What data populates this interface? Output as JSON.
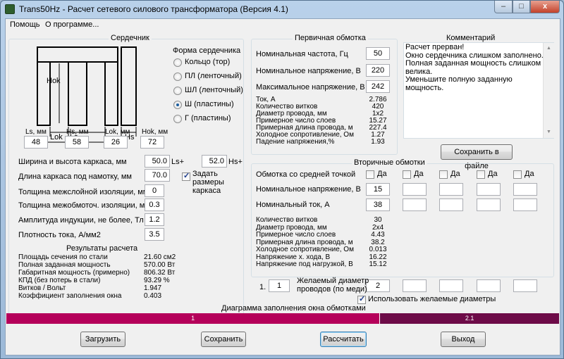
{
  "window": {
    "title": "Trans50Hz - Расчет сетевого силового трансформатора (Версия 4.1)",
    "min": "–",
    "max": "□",
    "close": "x"
  },
  "menu": {
    "help": "Помощь",
    "about": "О программе..."
  },
  "core": {
    "title": "Сердечник",
    "form_title": "Форма сердечника",
    "diagram": {
      "hok": "Hok",
      "lok": "Lok",
      "ls": "Ls",
      "hs": "Hs"
    },
    "radios": [
      {
        "label": "Кольцо  (тор)",
        "checked": false
      },
      {
        "label": "ПЛ  (ленточный)",
        "checked": false
      },
      {
        "label": "ШЛ  (ленточный)",
        "checked": false
      },
      {
        "label": "Ш  (пластины)",
        "checked": true
      },
      {
        "label": "Г  (пластины)",
        "checked": false
      }
    ],
    "dims": [
      {
        "label": "Ls, мм",
        "value": "48"
      },
      {
        "label": "Hs, мм",
        "value": "58"
      },
      {
        "label": "Lok, мм",
        "value": "26"
      },
      {
        "label": "Hok, мм",
        "value": "72"
      }
    ],
    "frame_label": "Ширина и высота каркаса, мм",
    "frame_w": "50.0",
    "frame_w_unit": "Ls+",
    "frame_h": "52.0",
    "frame_h_unit": "Hs+",
    "length_label": "Длина каркаса под намотку, мм",
    "length_value": "70.0",
    "set_frame_label": "Задать размеры каркаса",
    "set_frame_checked": true,
    "interlayer_label": "Толщина межслойной изоляции, мм",
    "interlayer_value": "0",
    "interwinding_label": "Толщина межобмоточ. изоляции, мм",
    "interwinding_value": "0.3",
    "induction_label": "Амплитуда индукции, не более, Тл",
    "induction_value": "1.2",
    "current_density_label": "Плотность тока, А/мм2",
    "current_density_value": "3.5",
    "results_title": "Результаты расчета",
    "results": [
      {
        "label": "Площадь сечения по стали",
        "value": "21.60 см2"
      },
      {
        "label": "Полная заданная мощность",
        "value": "570.00 Вт"
      },
      {
        "label": "Габаритная мощность (примерно)",
        "value": "806.32 Вт"
      },
      {
        "label": "КПД (без потерь в стали)",
        "value": "93.29 %"
      },
      {
        "label": "Витков / Вольт",
        "value": "1.947"
      },
      {
        "label": "Коэффициент заполнения окна",
        "value": "0.403"
      }
    ]
  },
  "primary": {
    "title": "Первичная обмотка",
    "freq_label": "Номинальная частота, Гц",
    "freq_value": "50",
    "nominal_v_label": "Номинальное напряжение, В",
    "nominal_v_value": "220",
    "max_v_label": "Максимальное напряжение, В",
    "max_v_value": "242",
    "results": [
      {
        "label": "Ток, А",
        "value": "2.786"
      },
      {
        "label": "Количество витков",
        "value": "420"
      },
      {
        "label": "Диаметр провода, мм",
        "value": "1x2"
      },
      {
        "label": "Примерное число слоев",
        "value": "15.27"
      },
      {
        "label": "Примерная длина провода, м",
        "value": "227.4"
      },
      {
        "label": "Холодное сопротивление, Ом",
        "value": "1.27"
      },
      {
        "label": "Падение напряжения,%",
        "value": "1.93"
      }
    ]
  },
  "comment": {
    "title": "Комментарий",
    "text": "Расчет прерван!\nОкно сердечника слишком заполнено.\nПолная заданная мощность слишком велика.\nУменьшите полную заданную мощность.",
    "save_button": "Сохранить в файле"
  },
  "secondary": {
    "title": "Вторичные обмотки",
    "center_tap_label": "Обмотка со средней точкой",
    "yes": "Да",
    "center_tap": [
      false,
      false,
      false,
      false,
      false
    ],
    "voltage_label": "Номинальное напряжение, В",
    "voltages": [
      "15",
      "",
      "",
      "",
      ""
    ],
    "current_label": "Номинальный ток, А",
    "currents": [
      "38",
      "",
      "",
      "",
      ""
    ],
    "results": [
      {
        "label": "Количество витков",
        "value": "30"
      },
      {
        "label": "Диаметр провода, мм",
        "value": "2x4"
      },
      {
        "label": "Примерное число слоев",
        "value": "4.43"
      },
      {
        "label": "Примерная длина провода, м",
        "value": "38.2"
      },
      {
        "label": "Холодное сопротивление, Ом",
        "value": "0.013"
      },
      {
        "label": "Напряжение х. хода, В",
        "value": "16.22"
      },
      {
        "label": "Напряжение под нагрузкой, В",
        "value": "15.12"
      }
    ],
    "wire_count_label": "1.",
    "wire_count_value": "1",
    "desired_diam_label": "Желаемый диаметр\nпроводов  (по меди)",
    "desired_diam": [
      "2",
      "",
      "",
      "",
      ""
    ],
    "use_desired_label": "Использовать желаемые диаметры",
    "use_desired_checked": true
  },
  "fill_diagram": {
    "title": "Диаграмма заполнения окна обмотками",
    "segments": [
      {
        "label": "1",
        "fraction": 0.675,
        "color": "#b5005a"
      },
      {
        "label": "2.1",
        "fraction": 0.325,
        "color": "#6d0b48"
      }
    ]
  },
  "buttons": {
    "load": "Загрузить",
    "save": "Сохранить",
    "calculate": "Рассчитать",
    "exit": "Выход"
  }
}
